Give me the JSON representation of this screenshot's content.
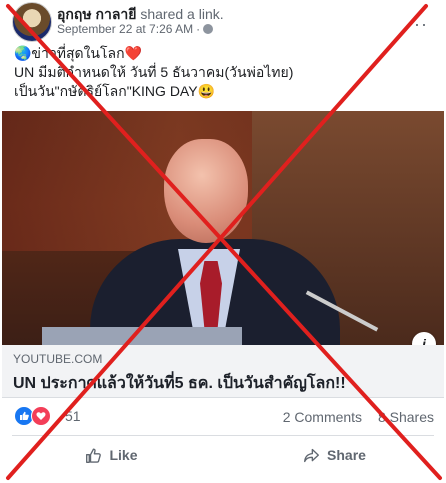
{
  "post": {
    "author": "อุกฤษ กาลายี",
    "action": "shared a link.",
    "timestamp": "September 22 at 7:26 AM",
    "separator": "·",
    "more_label": "···",
    "text_lines": [
      "🌏ข่าวที่สุดในโลก❤️",
      "UN มีมติกำหนดให้ วันที่ 5 ธันวาคม(วันพ่อไทย)",
      "เป็นวัน\"กษัตริย์โลก\"KING DAY😃"
    ]
  },
  "link": {
    "domain": "YOUTUBE.COM",
    "title": "UN ประกาศแล้วให้วันที่5 ธค. เป็นวันสำคัญโลก!!",
    "info_label": "i"
  },
  "engagement": {
    "reaction_count": "51",
    "comments": "2 Comments",
    "shares": "8 Shares"
  },
  "actions": {
    "like": "Like",
    "share": "Share"
  },
  "colors": {
    "cross": "#e0201e",
    "like_blue": "#1877f2",
    "love_red": "#f33e58"
  }
}
